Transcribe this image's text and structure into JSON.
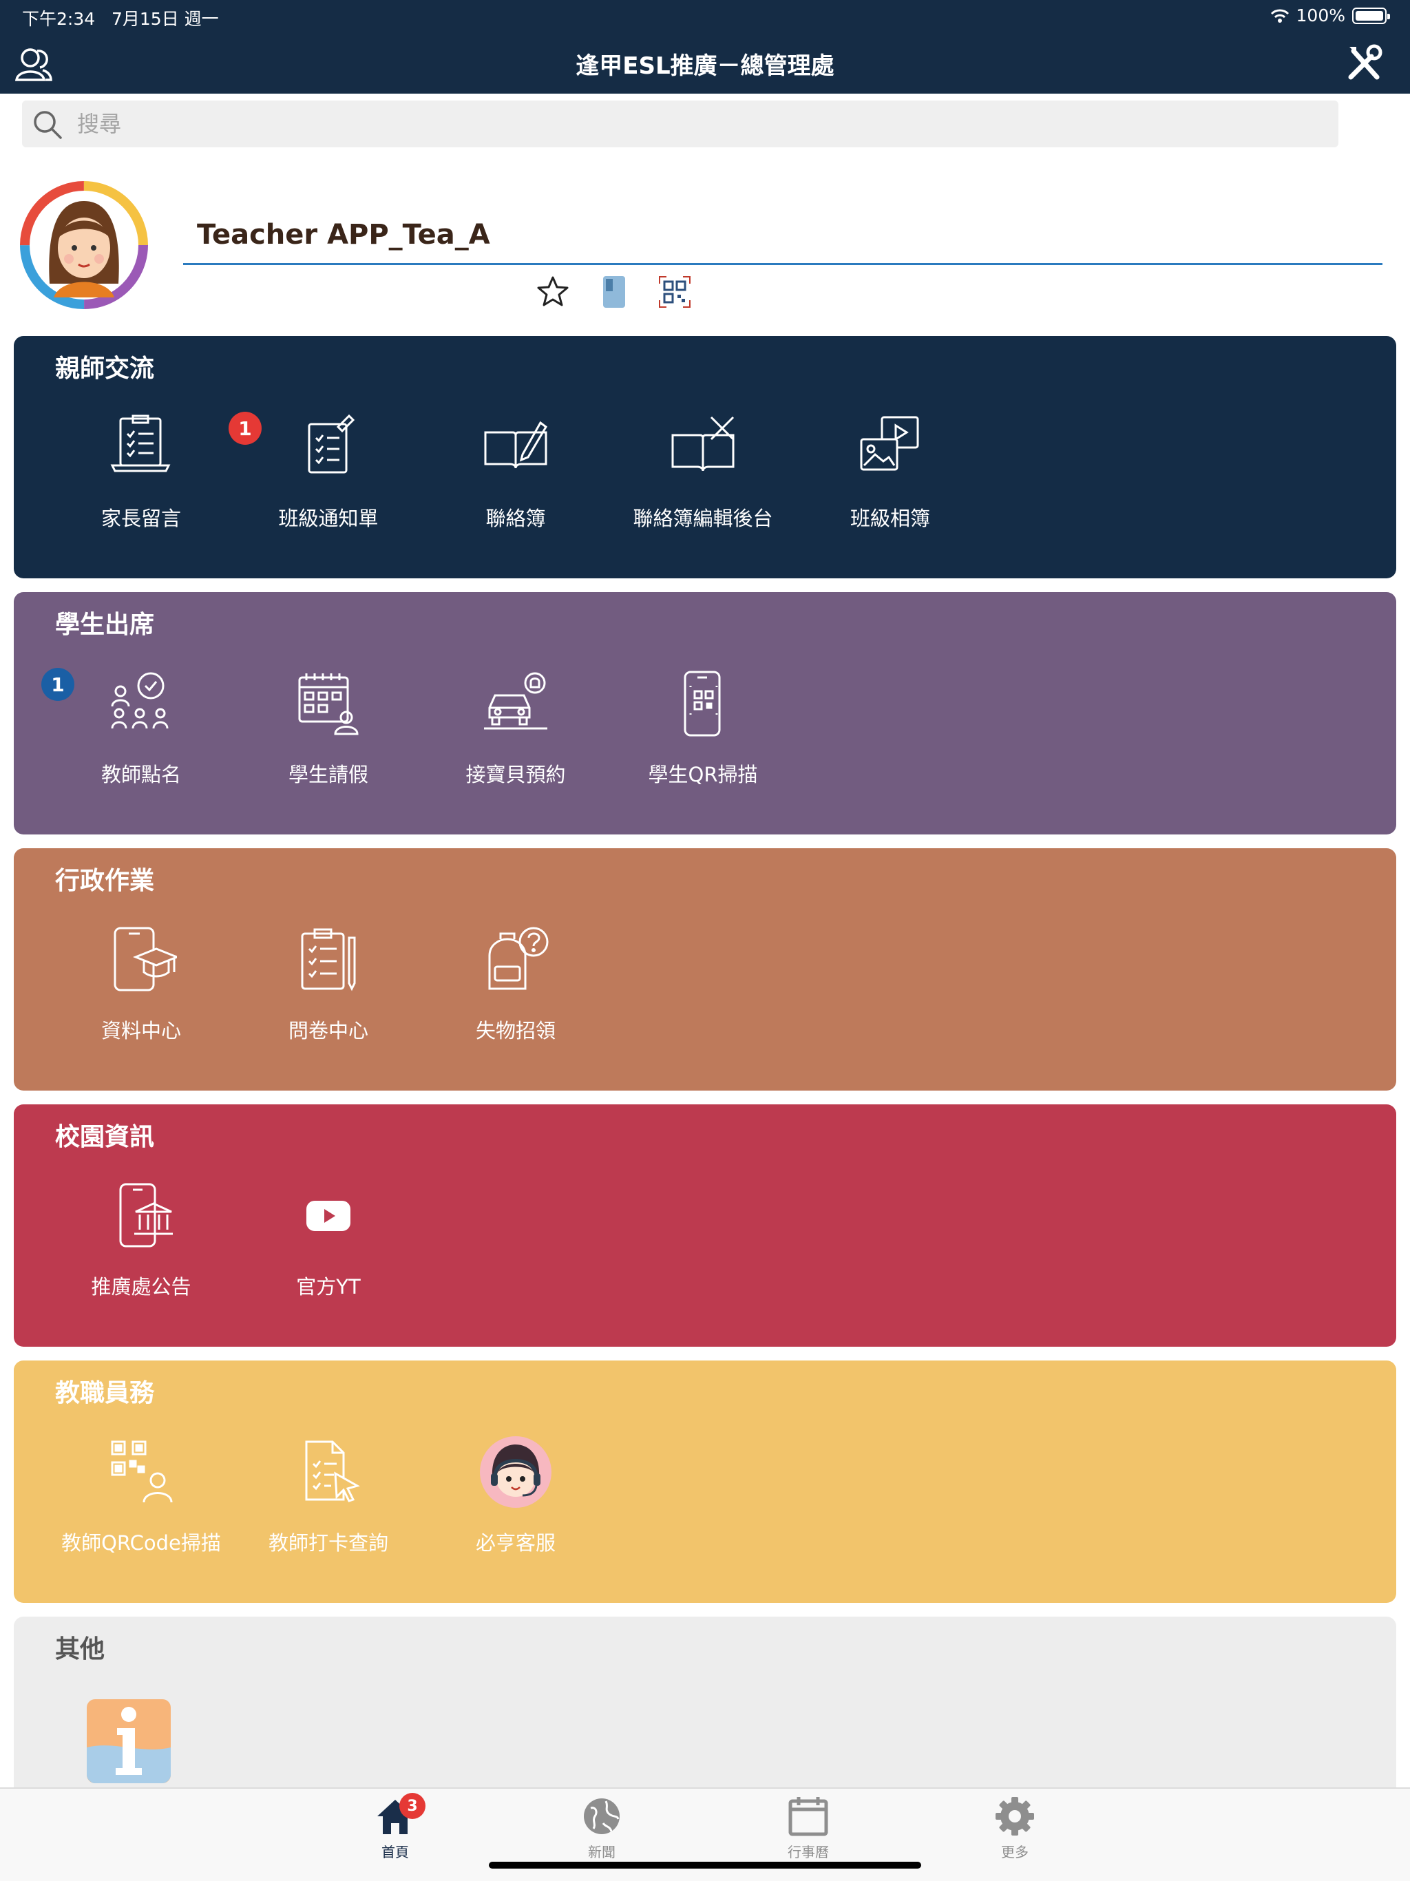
{
  "status_bar": {
    "time": "下午2:34",
    "date": "7月15日 週一",
    "battery": "100%"
  },
  "header": {
    "title": "逢甲ESL推廣－總管理處"
  },
  "search": {
    "placeholder": "搜尋"
  },
  "profile": {
    "name": "Teacher APP_Tea_A"
  },
  "sections": {
    "parent_teacher": {
      "title": "親師交流",
      "color": "#142c46",
      "items": [
        "家長留言",
        "班級通知單",
        "聯絡簿",
        "聯絡簿編輯後台",
        "班級相簿"
      ],
      "badge": "1"
    },
    "attendance": {
      "title": "學生出席",
      "color": "#725c80",
      "items": [
        "教師點名",
        "學生請假",
        "接寶貝預約",
        "學生QR掃描"
      ],
      "badge": "1"
    },
    "admin": {
      "title": "行政作業",
      "color": "#be7a5b",
      "items": [
        "資料中心",
        "問卷中心",
        "失物招領"
      ]
    },
    "campus": {
      "title": "校園資訊",
      "color": "#bd3a4f",
      "items": [
        "推廣處公告",
        "官方YT"
      ]
    },
    "staff": {
      "title": "教職員務",
      "color": "#f2c46b",
      "items": [
        "教師QRCode掃描",
        "教師打卡查詢",
        "必亨客服"
      ]
    },
    "other": {
      "title": "其他",
      "color": "#ededed"
    }
  },
  "tabbar": {
    "items": [
      "首頁",
      "新聞",
      "行事曆",
      "更多"
    ],
    "home_badge": "3"
  }
}
